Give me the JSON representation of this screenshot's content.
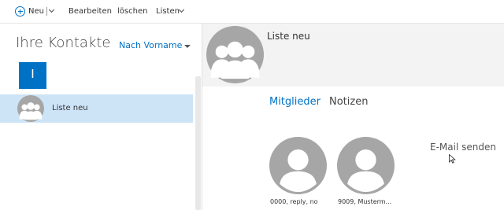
{
  "toolbar": {
    "new_label": "Neu",
    "edit_label": "Bearbeiten",
    "delete_label": "löschen",
    "lists_label": "Listen"
  },
  "sidebar": {
    "title": "Ihre Kontakte",
    "sort_label": "Nach Vorname",
    "letter": "I",
    "items": [
      {
        "label": "Liste neu"
      }
    ]
  },
  "detail": {
    "name": "Liste neu",
    "tabs": [
      {
        "label": "Mitglieder",
        "active": true
      },
      {
        "label": "Notizen",
        "active": false
      }
    ],
    "members": [
      {
        "name": "0000, reply, no"
      },
      {
        "name": "9009, Musterm..."
      }
    ],
    "action_label": "E-Mail senden"
  },
  "colors": {
    "accent": "#0072c6",
    "selected_row": "#cde4f7",
    "header_bg": "#f3f3f3",
    "avatar_gray": "#a6a6a6"
  },
  "icons": {
    "new": "plus-circle-icon",
    "group_avatar": "group-avatar-icon",
    "person_avatar": "person-avatar-icon"
  }
}
